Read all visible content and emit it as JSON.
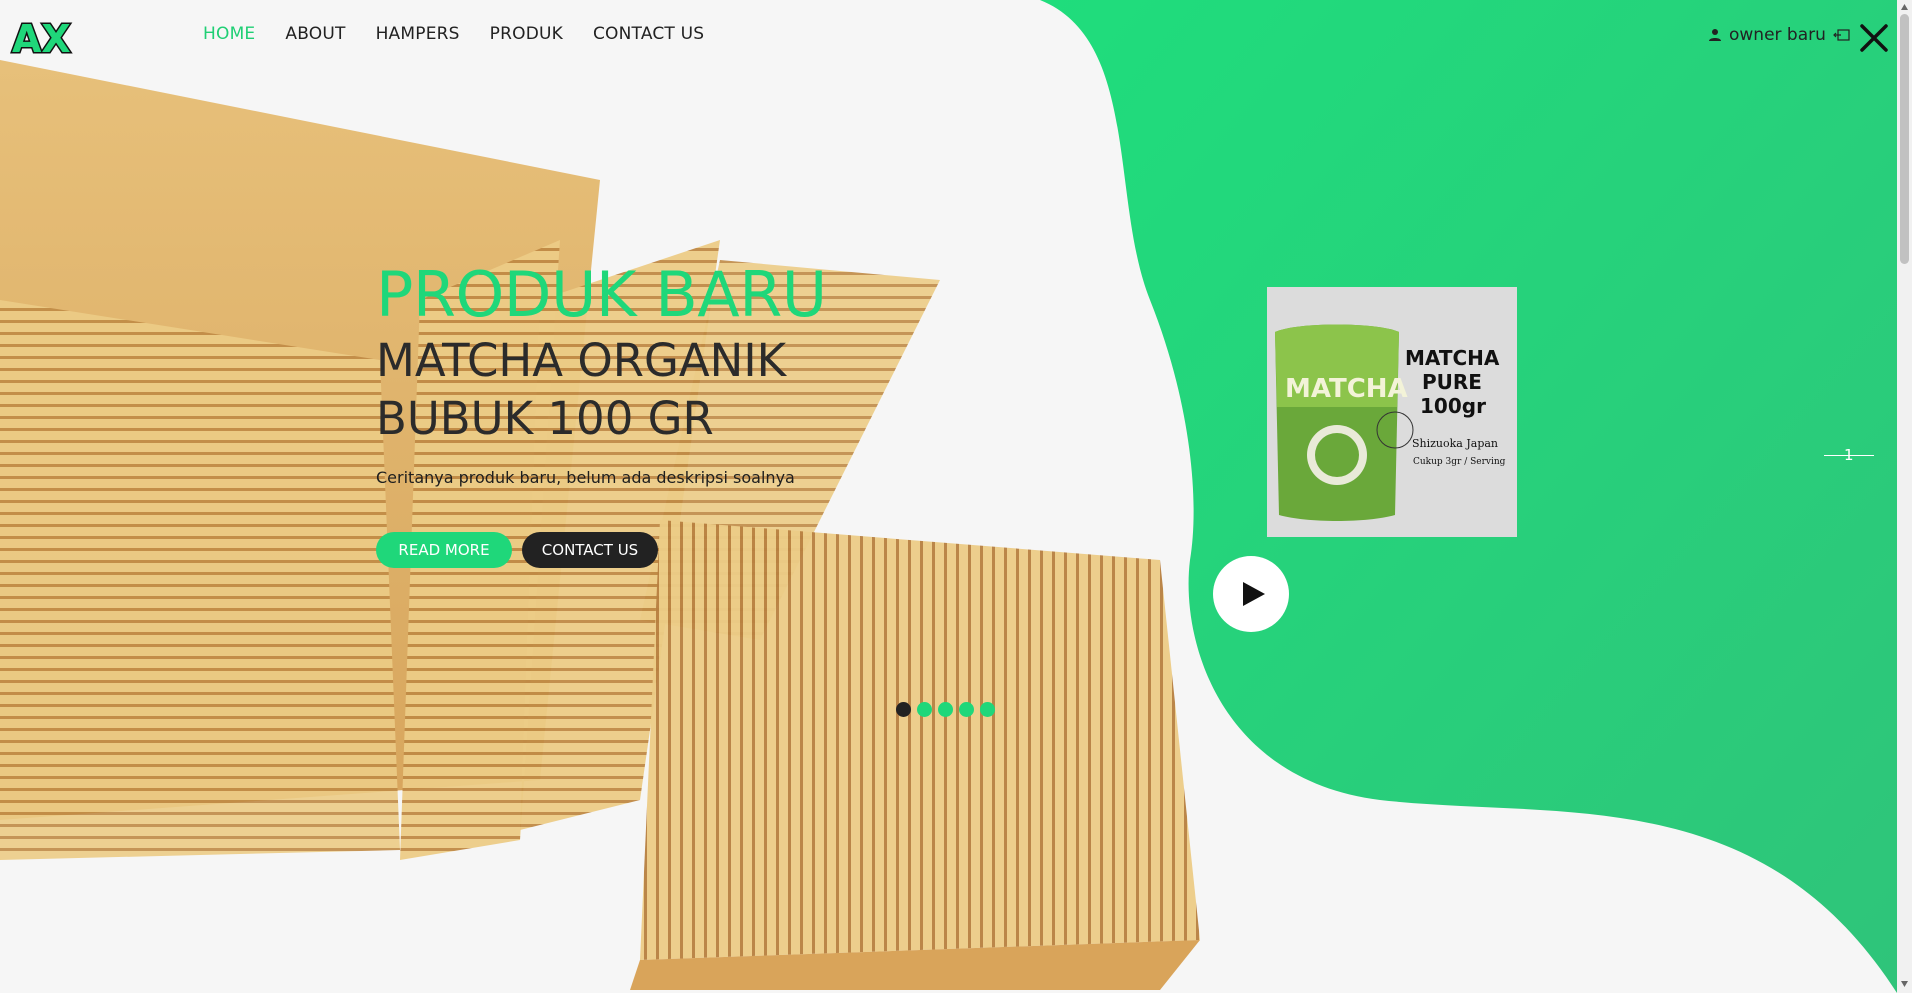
{
  "header": {
    "logo_text": "AX",
    "nav": [
      {
        "label": "HOME",
        "active": true
      },
      {
        "label": "ABOUT",
        "active": false
      },
      {
        "label": "HAMPERS",
        "active": false
      },
      {
        "label": "PRODUK",
        "active": false
      },
      {
        "label": "CONTACT US",
        "active": false
      }
    ],
    "user_name": "owner baru",
    "icons": {
      "user": "user-icon",
      "logout": "logout-icon",
      "close": "close-icon"
    }
  },
  "hero": {
    "tag": "PRODUK BARU",
    "title": "MATCHA ORGANIK BUBUK 100 GR",
    "description": "Ceritanya produk baru, belum ada deskripsi soalnya",
    "read_more_label": "READ MORE",
    "contact_label": "CONTACT US"
  },
  "product_card": {
    "brand_text": "MATCHA",
    "line1": "MATCHA",
    "line2": "PURE",
    "line3": "100gr",
    "origin": "Shizuoka Japan",
    "serving": "Cukup 3gr / Serving"
  },
  "slider": {
    "dots_total": 5,
    "active_dot": 0,
    "current_slide": "1"
  },
  "colors": {
    "accent": "#1fd77a",
    "dark": "#222222",
    "background": "#f6f6f6"
  }
}
